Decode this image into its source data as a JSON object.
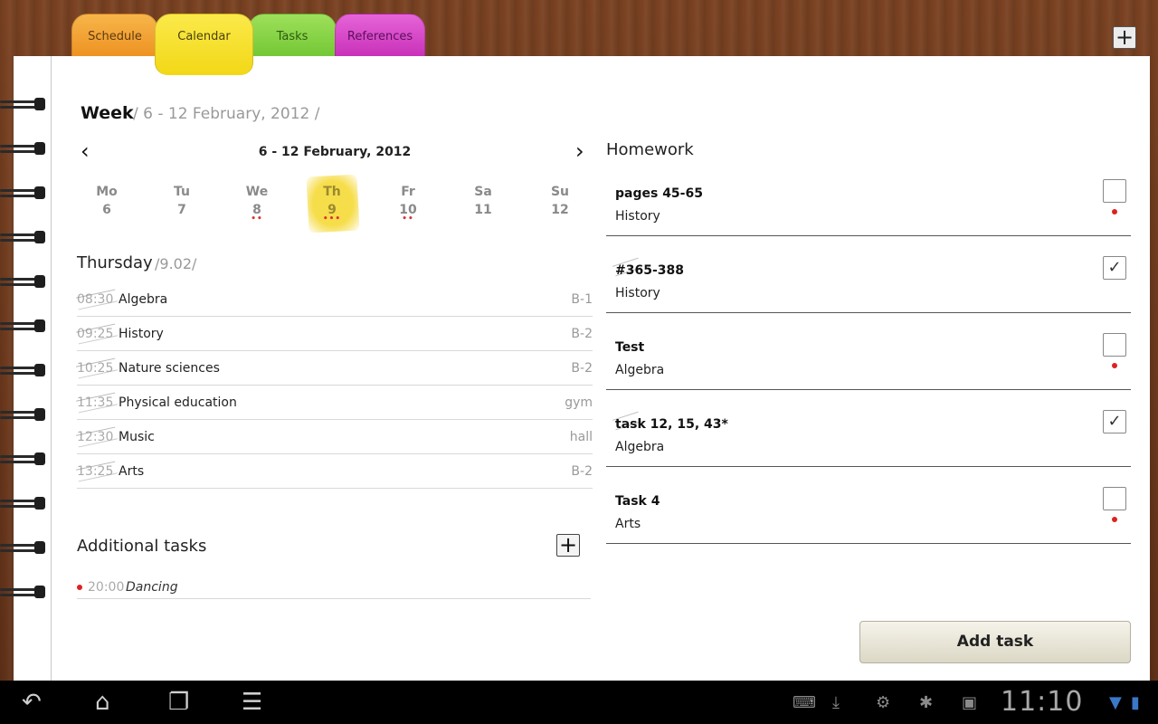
{
  "tabs": [
    {
      "label": "Schedule"
    },
    {
      "label": "Calendar"
    },
    {
      "label": "Tasks"
    },
    {
      "label": "References"
    }
  ],
  "top_add_label": "+",
  "week": {
    "title": "Week",
    "range": "/ 6 - 12 February, 2012 /",
    "nav_label": "6 - 12 February, 2012",
    "prev_icon": "‹",
    "next_icon": "›",
    "days": [
      {
        "name": "Mo",
        "num": "6",
        "dots": ""
      },
      {
        "name": "Tu",
        "num": "7",
        "dots": ""
      },
      {
        "name": "We",
        "num": "8",
        "dots": "••"
      },
      {
        "name": "Th",
        "num": "9",
        "dots": "•••"
      },
      {
        "name": "Fr",
        "num": "10",
        "dots": "••"
      },
      {
        "name": "Sa",
        "num": "11",
        "dots": ""
      },
      {
        "name": "Su",
        "num": "12",
        "dots": ""
      }
    ],
    "selected_day": "Th"
  },
  "day": {
    "title": "Thursday",
    "date": "/9.02/",
    "lessons": [
      {
        "time": "08:30",
        "subject": "Algebra",
        "room": "B-1"
      },
      {
        "time": "09:25",
        "subject": "History",
        "room": "B-2"
      },
      {
        "time": "10:25",
        "subject": "Nature sciences",
        "room": "B-2"
      },
      {
        "time": "11:35",
        "subject": "Physical education",
        "room": "gym"
      },
      {
        "time": "12:30",
        "subject": "Music",
        "room": "hall"
      },
      {
        "time": "13:25",
        "subject": "Arts",
        "room": "B-2"
      }
    ]
  },
  "additional": {
    "title": "Additional tasks",
    "add_label": "+",
    "items": [
      {
        "time": "20:00",
        "name": "Dancing"
      }
    ]
  },
  "homework": {
    "title": "Homework",
    "items": [
      {
        "task": "pages 45-65",
        "subject": "History",
        "done": false,
        "check": ""
      },
      {
        "task": "#365-388",
        "subject": "History",
        "done": true,
        "check": "✓"
      },
      {
        "task": "Test",
        "subject": "Algebra",
        "done": false,
        "check": ""
      },
      {
        "task": "task 12, 15,  43*",
        "subject": "Algebra",
        "done": true,
        "check": "✓"
      },
      {
        "task": "Task 4",
        "subject": "Arts",
        "done": false,
        "check": ""
      }
    ],
    "add_task_label": "Add task"
  },
  "system_bar": {
    "back_icon": "↶",
    "home_icon": "⌂",
    "recent_icon": "❐",
    "menu_icon": "☰",
    "clock": "11:10"
  },
  "colors": {
    "schedule_tab": "#ec8f1e",
    "calendar_tab": "#f2d816",
    "tasks_tab": "#6fc532",
    "references_tab": "#c52cb5",
    "today_highlight": "#f6dd4a",
    "dot_red": "#d22222"
  }
}
